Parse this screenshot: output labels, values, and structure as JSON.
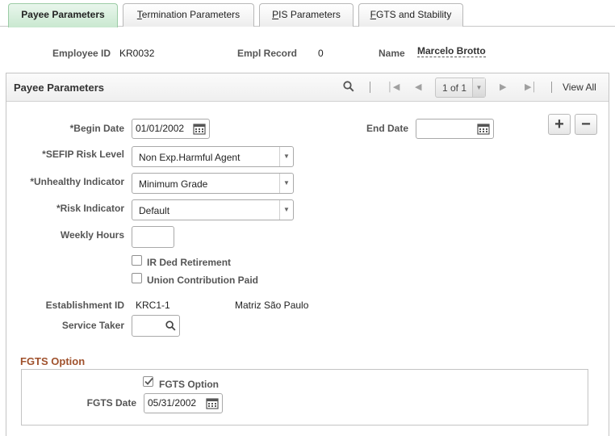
{
  "tabs": [
    {
      "label": "Payee Parameters",
      "active": true
    },
    {
      "label_prefix": "",
      "label_accel": "T",
      "label_rest": "ermination Parameters"
    },
    {
      "label_prefix": "",
      "label_accel": "P",
      "label_rest": "IS Parameters"
    },
    {
      "label_prefix": "",
      "label_accel": "F",
      "label_rest": "GTS and Stability"
    }
  ],
  "header": {
    "employee_id_label": "Employee ID",
    "employee_id": "KR0032",
    "empl_record_label": "Empl Record",
    "empl_record": "0",
    "name_label": "Name",
    "name": "Marcelo Brotto"
  },
  "panel": {
    "title": "Payee Parameters",
    "pager": "1 of 1",
    "view_all": "View All"
  },
  "form": {
    "begin_date_label": "*Begin Date",
    "begin_date": "01/01/2002",
    "end_date_label": "End Date",
    "end_date": "",
    "sefip_label": "*SEFIP Risk Level",
    "sefip_value": "Non Exp.Harmful Agent",
    "unhealthy_label": "*Unhealthy Indicator",
    "unhealthy_value": "Minimum Grade",
    "risk_label": "*Risk Indicator",
    "risk_value": "Default",
    "weekly_hours_label": "Weekly Hours",
    "weekly_hours": "",
    "ir_ded_label": "IR Ded Retirement",
    "ir_ded_checked": false,
    "union_label": "Union Contribution Paid",
    "union_checked": false,
    "establishment_label": "Establishment ID",
    "establishment_id": "KRC1-1",
    "establishment_name": "Matriz São Paulo",
    "service_taker_label": "Service Taker",
    "service_taker": ""
  },
  "fgts": {
    "section_title": "FGTS Option",
    "option_label": "FGTS Option",
    "option_checked": true,
    "date_label": "FGTS Date",
    "date": "05/31/2002"
  },
  "colors": {
    "active_tab": "#c9e8d0",
    "section_title": "#a0522d"
  }
}
